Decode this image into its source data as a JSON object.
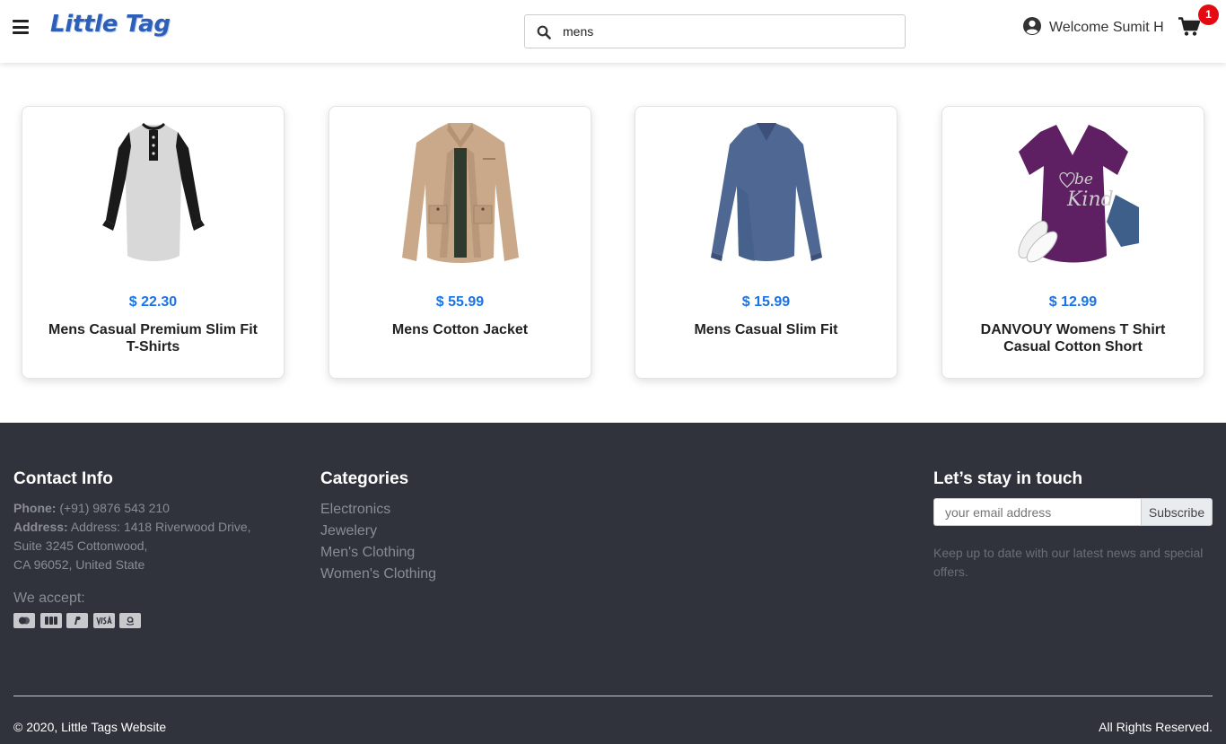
{
  "header": {
    "logo": "Little Tag",
    "search_value": "mens",
    "welcome": "Welcome Sumit H",
    "cart_count": "1"
  },
  "products": [
    {
      "price": "$ 22.30",
      "name": "Mens Casual Premium Slim Fit T-Shirts",
      "image": "raglan-henley-shirt"
    },
    {
      "price": "$ 55.99",
      "name": "Mens Cotton Jacket",
      "image": "khaki-jacket"
    },
    {
      "price": "$ 15.99",
      "name": "Mens Casual Slim Fit",
      "image": "blue-long-sleeve-shirt"
    },
    {
      "price": "$ 12.99",
      "name": "DANVOUY Womens T Shirt Casual Cotton Short",
      "image": "purple-be-kind-tshirt"
    }
  ],
  "footer": {
    "contact": {
      "title": "Contact Info",
      "phone_label": "Phone:",
      "phone": "(+91) 9876 543 210",
      "address_label": "Address:",
      "address_line1": "Address: 1418 Riverwood Drive,",
      "address_line2": "Suite 3245 Cottonwood,",
      "address_line3": "CA 96052, United State",
      "accept": "We accept:",
      "payment_icons": [
        "mastercard-icon",
        "jcb-icon",
        "paypal-icon",
        "visa-icon",
        "amazon-icon"
      ]
    },
    "categories": {
      "title": "Categories",
      "items": [
        "Electronics",
        "Jewelery",
        "Men's Clothing",
        "Women's Clothing"
      ]
    },
    "newsletter": {
      "title": "Let’s stay in touch",
      "placeholder": "your email address",
      "button": "Subscribe",
      "text": "Keep up to date with our latest news and special offers."
    },
    "copyright": "© 2020, Little Tags Website",
    "rights": "All Rights Reserved."
  },
  "colors": {
    "price": "#1a73e8",
    "footer_bg": "#31333c",
    "badge": "#e50914",
    "logo": "#2d5fb8"
  }
}
